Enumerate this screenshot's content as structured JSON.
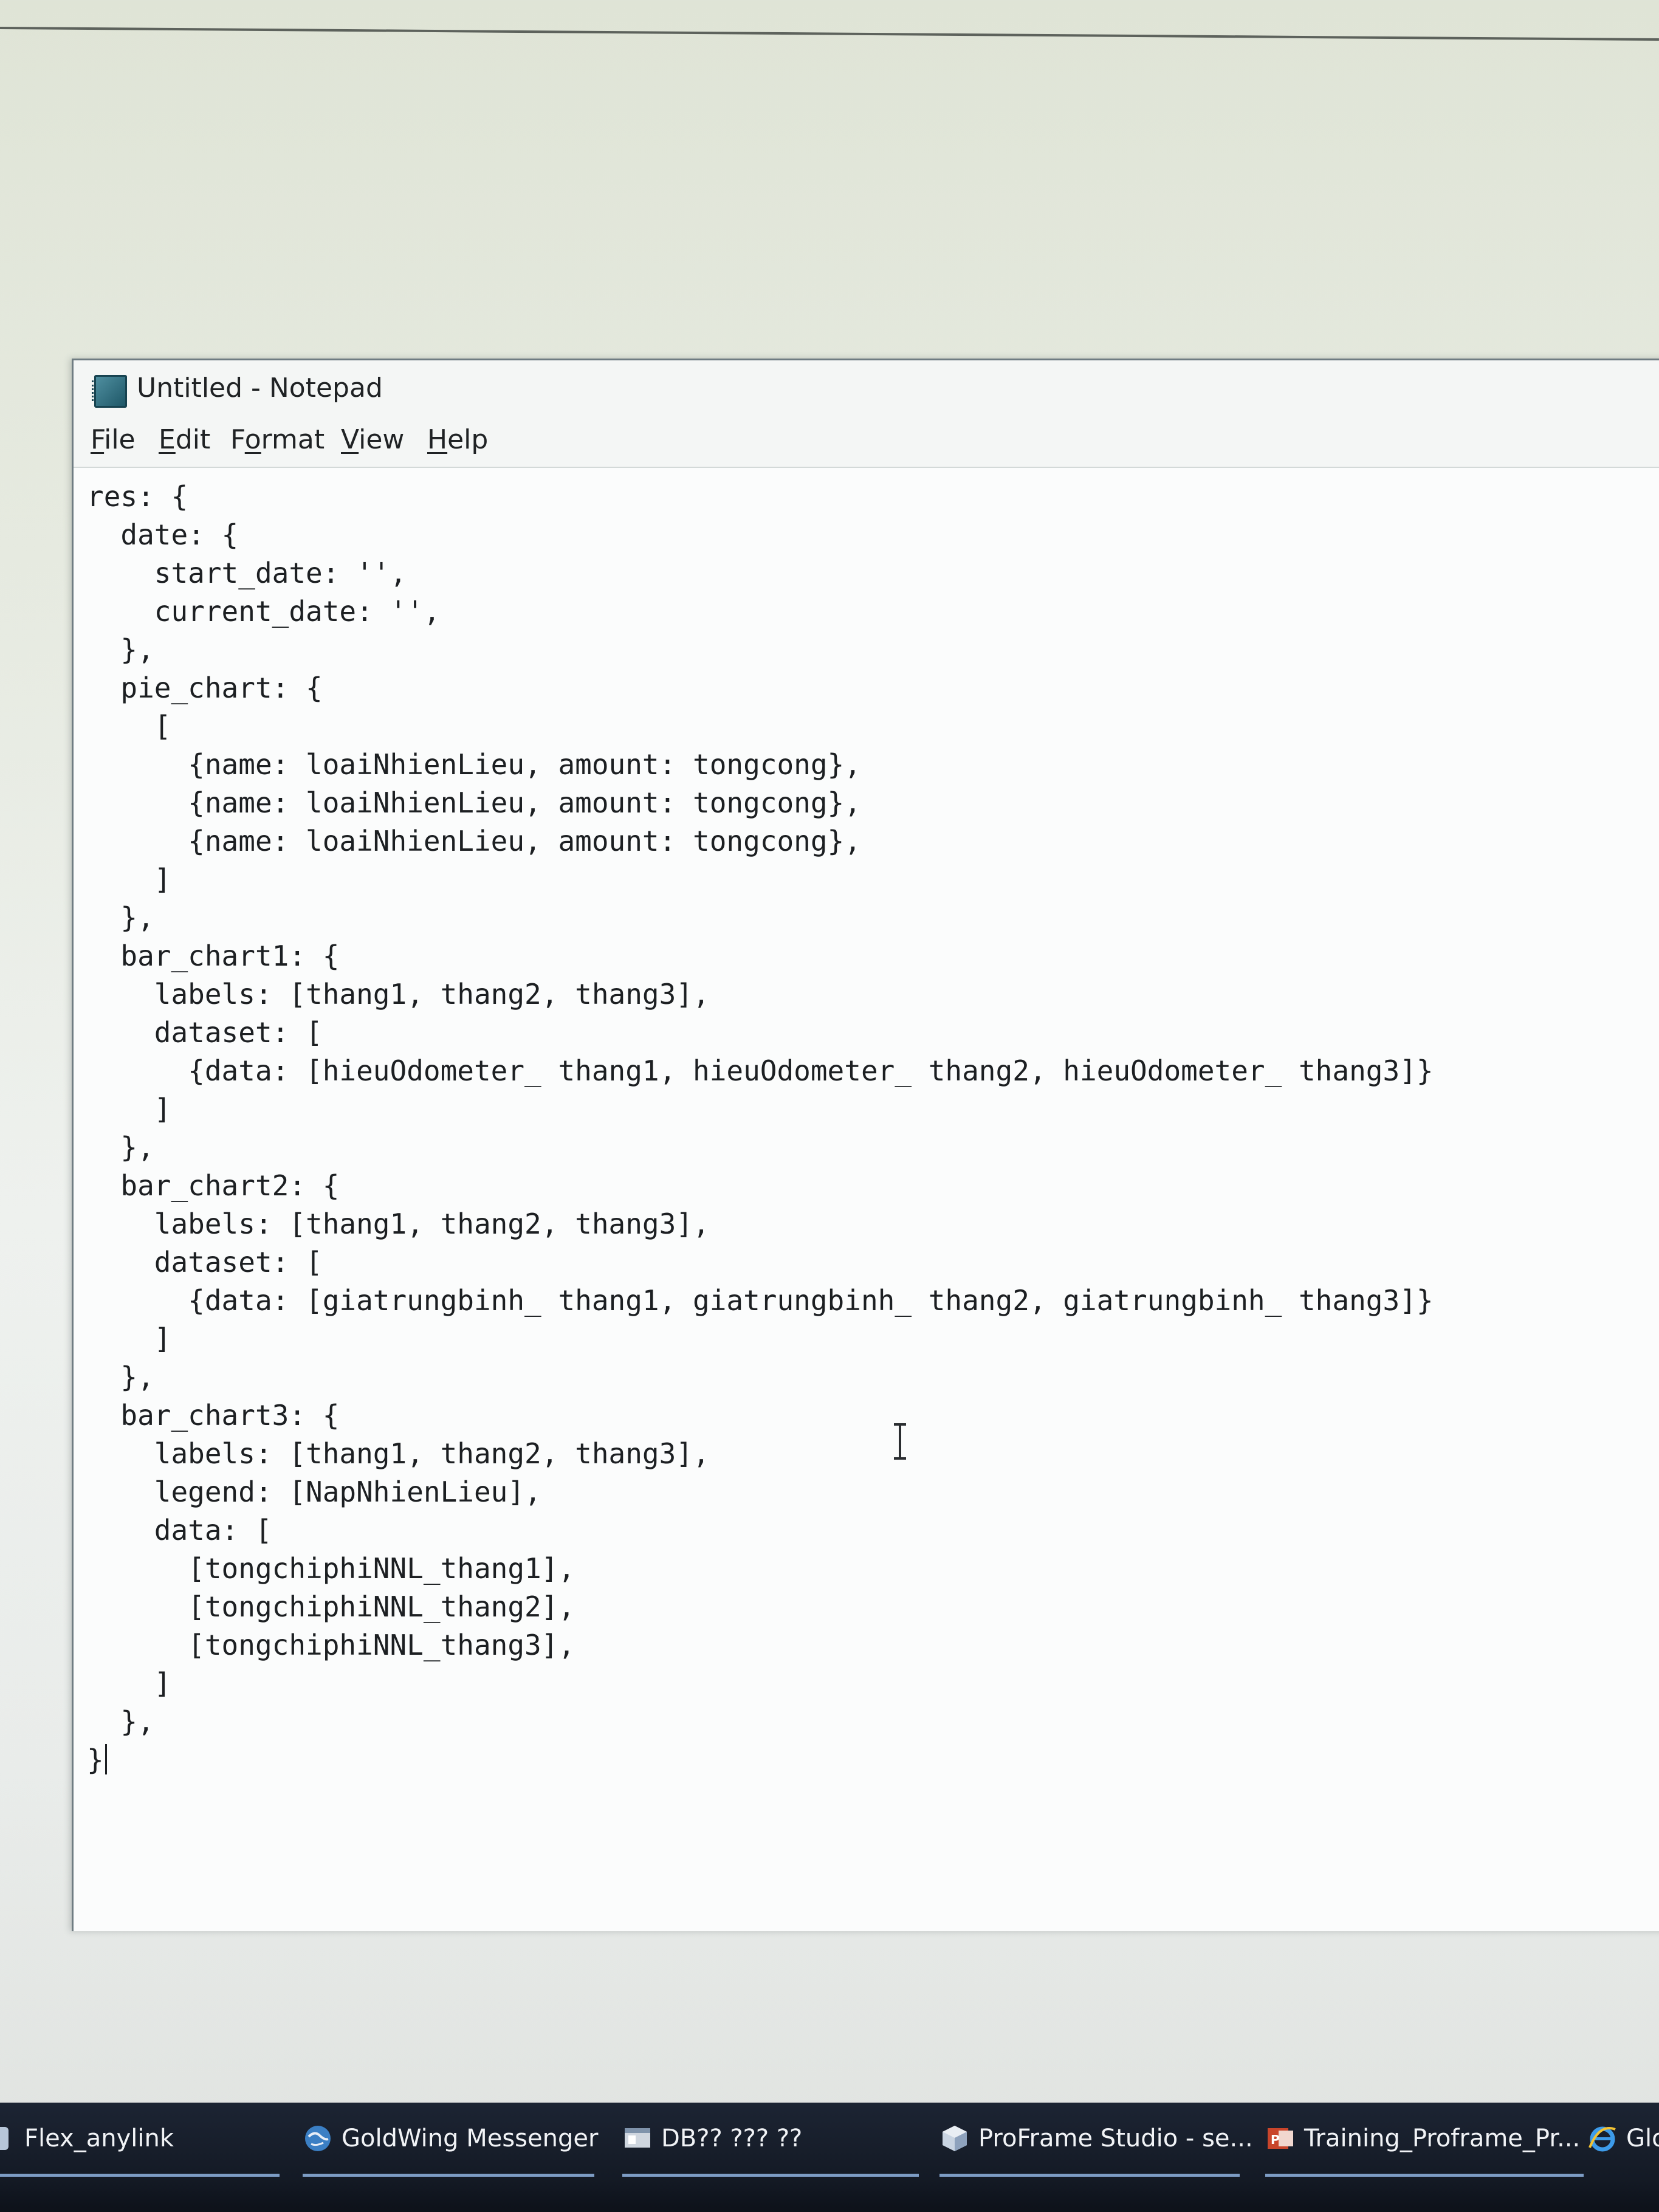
{
  "window": {
    "title": "Untitled - Notepad"
  },
  "menu": [
    {
      "mnemonic": "F",
      "rest": "ile"
    },
    {
      "mnemonic": "E",
      "rest": "dit"
    },
    {
      "mnemonic": "o",
      "pre": "F",
      "rest": "rmat"
    },
    {
      "mnemonic": "V",
      "rest": "iew"
    },
    {
      "mnemonic": "H",
      "rest": "elp"
    }
  ],
  "editor": {
    "lines": [
      "res: {",
      "  date: {",
      "    start_date: '',",
      "    current_date: '',",
      "  },",
      "  pie_chart: {",
      "    [",
      "      {name: loaiNhienLieu, amount: tongcong},",
      "      {name: loaiNhienLieu, amount: tongcong},",
      "      {name: loaiNhienLieu, amount: tongcong},",
      "    ]",
      "  },",
      "  bar_chart1: {",
      "    labels: [thang1, thang2, thang3],",
      "    dataset: [",
      "      {data: [hieuOdometer_ thang1, hieuOdometer_ thang2, hieuOdometer_ thang3]}",
      "    ]",
      "  },",
      "  bar_chart2: {",
      "    labels: [thang1, thang2, thang3],",
      "    dataset: [",
      "      {data: [giatrungbinh_ thang1, giatrungbinh_ thang2, giatrungbinh_ thang3]}",
      "    ]",
      "  },",
      "  bar_chart3: {",
      "    labels: [thang1, thang2, thang3],",
      "    legend: [NapNhienLieu],",
      "    data: [",
      "      [tongchiphiNNL_thang1],",
      "      [tongchiphiNNL_thang2],",
      "      [tongchiphiNNL_thang3],",
      "    ]",
      "  },",
      "}"
    ]
  },
  "taskbar": {
    "items": [
      {
        "label": "Flex_anylink",
        "icon": "app-icon",
        "active": true
      },
      {
        "label": "GoldWing Messenger",
        "icon": "globe-icon",
        "active": true
      },
      {
        "label": "DB?? ??? ??",
        "icon": "window-icon",
        "active": true
      },
      {
        "label": "ProFrame Studio - se...",
        "icon": "cube-icon",
        "active": true
      },
      {
        "label": "Training_Proframe_Pr...",
        "icon": "powerpoint-icon",
        "active": true
      },
      {
        "label": "Glo",
        "icon": "internet-explorer-icon",
        "active": false
      }
    ]
  }
}
